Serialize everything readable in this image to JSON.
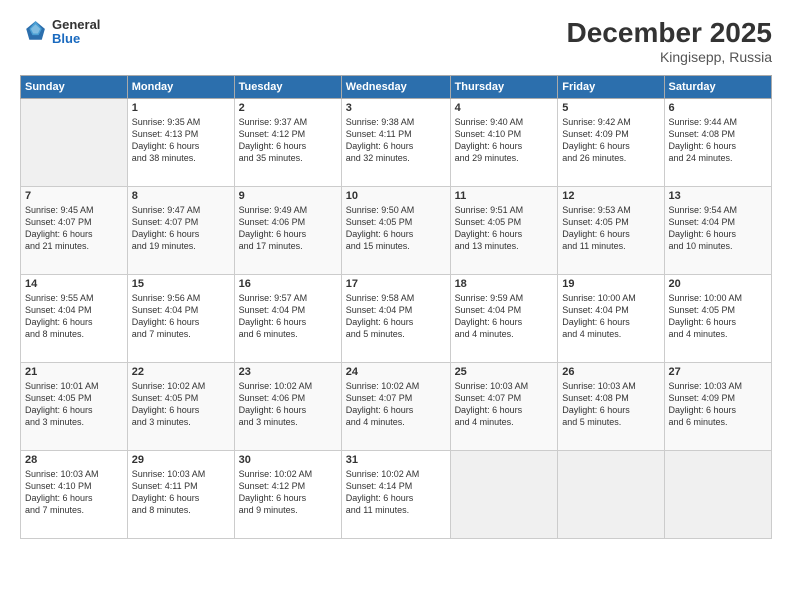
{
  "header": {
    "logo": {
      "general": "General",
      "blue": "Blue"
    },
    "title": "December 2025",
    "subtitle": "Kingisepp, Russia"
  },
  "calendar": {
    "days_of_week": [
      "Sunday",
      "Monday",
      "Tuesday",
      "Wednesday",
      "Thursday",
      "Friday",
      "Saturday"
    ],
    "weeks": [
      [
        {
          "day": "",
          "info": ""
        },
        {
          "day": "1",
          "info": "Sunrise: 9:35 AM\nSunset: 4:13 PM\nDaylight: 6 hours\nand 38 minutes."
        },
        {
          "day": "2",
          "info": "Sunrise: 9:37 AM\nSunset: 4:12 PM\nDaylight: 6 hours\nand 35 minutes."
        },
        {
          "day": "3",
          "info": "Sunrise: 9:38 AM\nSunset: 4:11 PM\nDaylight: 6 hours\nand 32 minutes."
        },
        {
          "day": "4",
          "info": "Sunrise: 9:40 AM\nSunset: 4:10 PM\nDaylight: 6 hours\nand 29 minutes."
        },
        {
          "day": "5",
          "info": "Sunrise: 9:42 AM\nSunset: 4:09 PM\nDaylight: 6 hours\nand 26 minutes."
        },
        {
          "day": "6",
          "info": "Sunrise: 9:44 AM\nSunset: 4:08 PM\nDaylight: 6 hours\nand 24 minutes."
        }
      ],
      [
        {
          "day": "7",
          "info": "Sunrise: 9:45 AM\nSunset: 4:07 PM\nDaylight: 6 hours\nand 21 minutes."
        },
        {
          "day": "8",
          "info": "Sunrise: 9:47 AM\nSunset: 4:07 PM\nDaylight: 6 hours\nand 19 minutes."
        },
        {
          "day": "9",
          "info": "Sunrise: 9:49 AM\nSunset: 4:06 PM\nDaylight: 6 hours\nand 17 minutes."
        },
        {
          "day": "10",
          "info": "Sunrise: 9:50 AM\nSunset: 4:05 PM\nDaylight: 6 hours\nand 15 minutes."
        },
        {
          "day": "11",
          "info": "Sunrise: 9:51 AM\nSunset: 4:05 PM\nDaylight: 6 hours\nand 13 minutes."
        },
        {
          "day": "12",
          "info": "Sunrise: 9:53 AM\nSunset: 4:05 PM\nDaylight: 6 hours\nand 11 minutes."
        },
        {
          "day": "13",
          "info": "Sunrise: 9:54 AM\nSunset: 4:04 PM\nDaylight: 6 hours\nand 10 minutes."
        }
      ],
      [
        {
          "day": "14",
          "info": "Sunrise: 9:55 AM\nSunset: 4:04 PM\nDaylight: 6 hours\nand 8 minutes."
        },
        {
          "day": "15",
          "info": "Sunrise: 9:56 AM\nSunset: 4:04 PM\nDaylight: 6 hours\nand 7 minutes."
        },
        {
          "day": "16",
          "info": "Sunrise: 9:57 AM\nSunset: 4:04 PM\nDaylight: 6 hours\nand 6 minutes."
        },
        {
          "day": "17",
          "info": "Sunrise: 9:58 AM\nSunset: 4:04 PM\nDaylight: 6 hours\nand 5 minutes."
        },
        {
          "day": "18",
          "info": "Sunrise: 9:59 AM\nSunset: 4:04 PM\nDaylight: 6 hours\nand 4 minutes."
        },
        {
          "day": "19",
          "info": "Sunrise: 10:00 AM\nSunset: 4:04 PM\nDaylight: 6 hours\nand 4 minutes."
        },
        {
          "day": "20",
          "info": "Sunrise: 10:00 AM\nSunset: 4:05 PM\nDaylight: 6 hours\nand 4 minutes."
        }
      ],
      [
        {
          "day": "21",
          "info": "Sunrise: 10:01 AM\nSunset: 4:05 PM\nDaylight: 6 hours\nand 3 minutes."
        },
        {
          "day": "22",
          "info": "Sunrise: 10:02 AM\nSunset: 4:05 PM\nDaylight: 6 hours\nand 3 minutes."
        },
        {
          "day": "23",
          "info": "Sunrise: 10:02 AM\nSunset: 4:06 PM\nDaylight: 6 hours\nand 3 minutes."
        },
        {
          "day": "24",
          "info": "Sunrise: 10:02 AM\nSunset: 4:07 PM\nDaylight: 6 hours\nand 4 minutes."
        },
        {
          "day": "25",
          "info": "Sunrise: 10:03 AM\nSunset: 4:07 PM\nDaylight: 6 hours\nand 4 minutes."
        },
        {
          "day": "26",
          "info": "Sunrise: 10:03 AM\nSunset: 4:08 PM\nDaylight: 6 hours\nand 5 minutes."
        },
        {
          "day": "27",
          "info": "Sunrise: 10:03 AM\nSunset: 4:09 PM\nDaylight: 6 hours\nand 6 minutes."
        }
      ],
      [
        {
          "day": "28",
          "info": "Sunrise: 10:03 AM\nSunset: 4:10 PM\nDaylight: 6 hours\nand 7 minutes."
        },
        {
          "day": "29",
          "info": "Sunrise: 10:03 AM\nSunset: 4:11 PM\nDaylight: 6 hours\nand 8 minutes."
        },
        {
          "day": "30",
          "info": "Sunrise: 10:02 AM\nSunset: 4:12 PM\nDaylight: 6 hours\nand 9 minutes."
        },
        {
          "day": "31",
          "info": "Sunrise: 10:02 AM\nSunset: 4:14 PM\nDaylight: 6 hours\nand 11 minutes."
        },
        {
          "day": "",
          "info": ""
        },
        {
          "day": "",
          "info": ""
        },
        {
          "day": "",
          "info": ""
        }
      ]
    ]
  }
}
